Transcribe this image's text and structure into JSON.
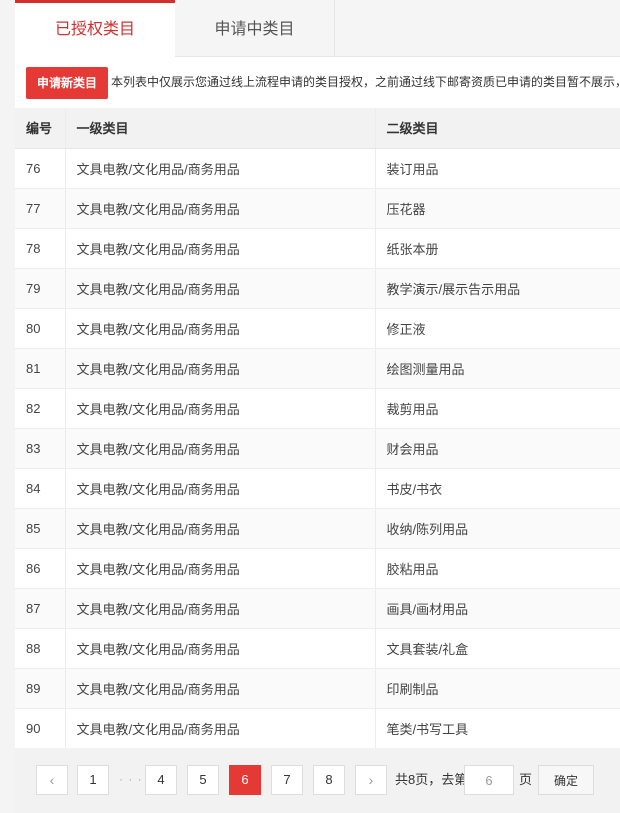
{
  "tabs": [
    {
      "label": "已授权类目",
      "active": true
    },
    {
      "label": "申请中类目",
      "active": false
    }
  ],
  "notice": {
    "apply_button": "申请新类目",
    "text": "本列表中仅展示您通过线上流程申请的类目授权，之前通过线下邮寄资质已申请的类目暂不展示，"
  },
  "table": {
    "headers": [
      "编号",
      "一级类目",
      "二级类目"
    ],
    "rows": [
      {
        "id": "76",
        "level1": "文具电教/文化用品/商务用品",
        "level2": "装订用品"
      },
      {
        "id": "77",
        "level1": "文具电教/文化用品/商务用品",
        "level2": "压花器"
      },
      {
        "id": "78",
        "level1": "文具电教/文化用品/商务用品",
        "level2": "纸张本册"
      },
      {
        "id": "79",
        "level1": "文具电教/文化用品/商务用品",
        "level2": "教学演示/展示告示用品"
      },
      {
        "id": "80",
        "level1": "文具电教/文化用品/商务用品",
        "level2": "修正液"
      },
      {
        "id": "81",
        "level1": "文具电教/文化用品/商务用品",
        "level2": "绘图测量用品"
      },
      {
        "id": "82",
        "level1": "文具电教/文化用品/商务用品",
        "level2": "裁剪用品"
      },
      {
        "id": "83",
        "level1": "文具电教/文化用品/商务用品",
        "level2": "财会用品"
      },
      {
        "id": "84",
        "level1": "文具电教/文化用品/商务用品",
        "level2": "书皮/书衣"
      },
      {
        "id": "85",
        "level1": "文具电教/文化用品/商务用品",
        "level2": "收纳/陈列用品"
      },
      {
        "id": "86",
        "level1": "文具电教/文化用品/商务用品",
        "level2": "胶粘用品"
      },
      {
        "id": "87",
        "level1": "文具电教/文化用品/商务用品",
        "level2": "画具/画材用品"
      },
      {
        "id": "88",
        "level1": "文具电教/文化用品/商务用品",
        "level2": "文具套装/礼盒"
      },
      {
        "id": "89",
        "level1": "文具电教/文化用品/商务用品",
        "level2": "印刷制品"
      },
      {
        "id": "90",
        "level1": "文具电教/文化用品/商务用品",
        "level2": "笔类/书写工具"
      }
    ]
  },
  "pagination": {
    "prev_icon": "‹",
    "next_icon": "›",
    "ellipsis": "· · ·",
    "pages": [
      "1",
      "4",
      "5",
      "6",
      "7",
      "8"
    ],
    "current": "6",
    "total_text": "共8页，去第",
    "goto_value": "6",
    "page_unit": "页",
    "confirm": "确定"
  },
  "colors": {
    "accent": "#e53935",
    "active_tab_text": "#d32f2f"
  }
}
